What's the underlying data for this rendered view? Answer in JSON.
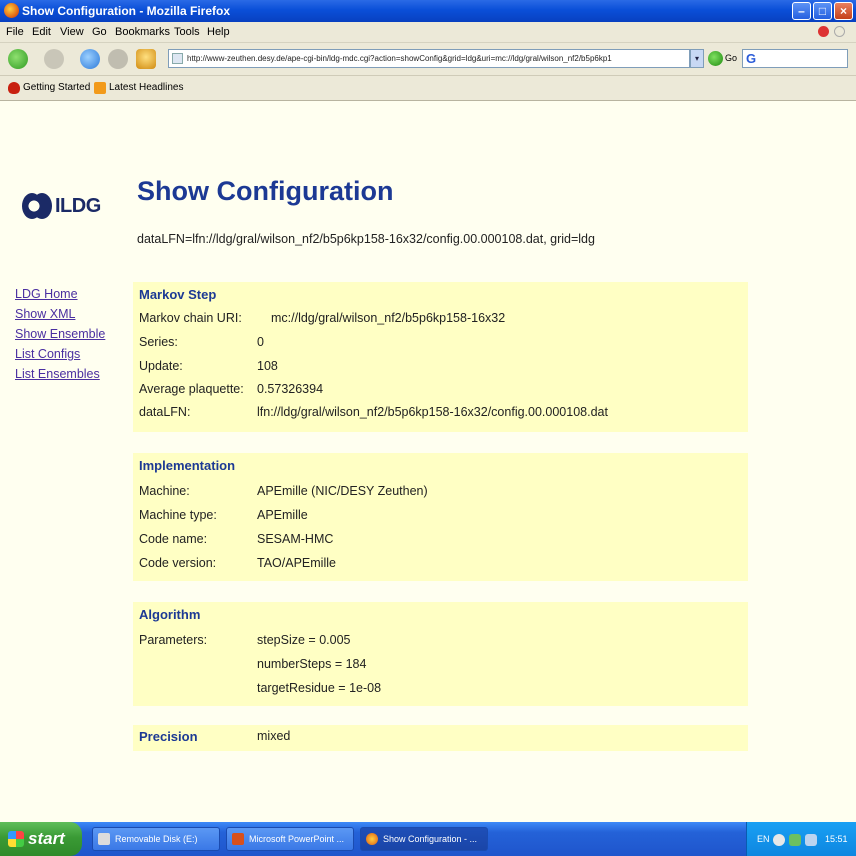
{
  "window": {
    "title": "Show Configuration - Mozilla Firefox"
  },
  "menu": [
    "File",
    "Edit",
    "View",
    "Go",
    "Bookmarks",
    "Tools",
    "Help"
  ],
  "navigation": {
    "url": "http://www-zeuthen.desy.de/ape-cgi-bin/ldg-mdc.cgi?action=showConfig&grid=ldg&uri=mc://ldg/gral/wilson_nf2/b5p6kp1",
    "go_label": "Go",
    "search_engine": "G"
  },
  "bookmarks": [
    "Getting Started",
    "Latest Headlines"
  ],
  "page": {
    "logo_text": "ILDG",
    "title": "Show Configuration",
    "subtitle": "dataLFN=lfn://ldg/gral/wilson_nf2/b5p6kp158-16x32/config.00.000108.dat, grid=ldg"
  },
  "sidenav": [
    "LDG Home",
    "Show XML",
    "Show Ensemble",
    "List Configs",
    "List Ensembles"
  ],
  "sections": {
    "markov": {
      "title": "Markov Step",
      "rows": [
        {
          "label": "Markov chain URI:",
          "value": "mc://ldg/gral/wilson_nf2/b5p6kp158-16x32"
        },
        {
          "label": "Series:",
          "value": "0"
        },
        {
          "label": "Update:",
          "value": "108"
        },
        {
          "label": "Average plaquette:",
          "value": "0.57326394"
        },
        {
          "label": "dataLFN:",
          "value": "lfn://ldg/gral/wilson_nf2/b5p6kp158-16x32/config.00.000108.dat"
        }
      ]
    },
    "implementation": {
      "title": "Implementation",
      "rows": [
        {
          "label": "Machine:",
          "value": "APEmille (NIC/DESY Zeuthen)"
        },
        {
          "label": "Machine type:",
          "value": "APEmille"
        },
        {
          "label": "Code name:",
          "value": "SESAM-HMC"
        },
        {
          "label": "Code version:",
          "value": "TAO/APEmille"
        }
      ]
    },
    "algorithm": {
      "title": "Algorithm",
      "label": "Parameters:",
      "values": [
        "stepSize = 0.005",
        "numberSteps = 184",
        "targetResidue = 1e-08"
      ]
    },
    "precision": {
      "title": "Precision",
      "value": "mixed"
    }
  },
  "taskbar": {
    "start_label": "start",
    "tasks": [
      "Removable Disk (E:)",
      "Microsoft PowerPoint ...",
      "Show Configuration - ..."
    ],
    "language": "EN",
    "clock": "15:51"
  },
  "colors": {
    "title_blue": "#1c3994",
    "section_bg": "#ffffc4",
    "page_bg": "#fffff0",
    "link": "#4a2fa0"
  }
}
